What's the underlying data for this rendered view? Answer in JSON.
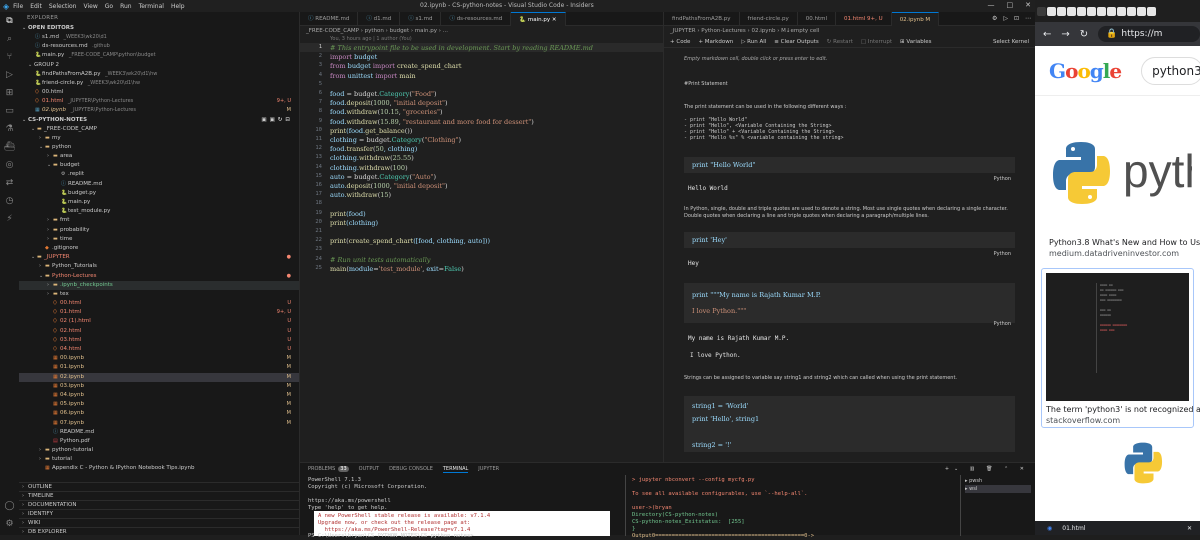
{
  "window": {
    "title": "02.ipynb - CS-python-notes - Visual Studio Code - Insiders",
    "menu": [
      "File",
      "Edit",
      "Selection",
      "View",
      "Go",
      "Run",
      "Terminal",
      "Help"
    ]
  },
  "sidebar": {
    "header": "EXPLORER",
    "open_editors": {
      "label": "OPEN EDITORS",
      "items": [
        {
          "name": "s1.md",
          "path": "_WEEK3\\wk20\\d1",
          "color": "#cccccc"
        },
        {
          "name": "ds-resources.md",
          "path": ".github",
          "color": "#cccccc"
        },
        {
          "name": "main.py",
          "path": "_FREE-CODE_CAMP\\python\\budget",
          "color": "#cccccc"
        }
      ],
      "group2_label": "GROUP 2",
      "group2_items": [
        {
          "name": "findPathsFromA2B.py",
          "path": "_WEEK3\\wk20\\d1\\hw",
          "color": "#cccccc"
        },
        {
          "name": "friend-circle.py",
          "path": "_WEEK3\\wk20\\d1\\hw",
          "color": "#cccccc"
        },
        {
          "name": "00.html",
          "path": "",
          "color": "#cccccc"
        },
        {
          "name": "01.html",
          "path": "_JUPYTER\\Python-Lectures",
          "color": "#f48771",
          "badge": "9+, U"
        },
        {
          "name": "02.ipynb",
          "path": "_JUPYTER\\Python-Lectures",
          "color": "#e2c08d",
          "badge": "M",
          "italic": true
        }
      ]
    },
    "workspace_label": "CS-PYTHON-NOTES",
    "tree": [
      {
        "indent": 1,
        "type": "folder",
        "open": true,
        "name": "_FREE-CODE_CAMP",
        "color": "#cccccc"
      },
      {
        "indent": 2,
        "type": "folder",
        "open": false,
        "name": "my",
        "color": "#cccccc"
      },
      {
        "indent": 2,
        "type": "folder",
        "open": true,
        "name": "python",
        "color": "#cccccc"
      },
      {
        "indent": 3,
        "type": "folder",
        "open": false,
        "name": "area",
        "color": "#cccccc"
      },
      {
        "indent": 3,
        "type": "folder",
        "open": true,
        "name": "budget",
        "color": "#cccccc"
      },
      {
        "indent": 4,
        "type": "file",
        "name": ".replit",
        "color": "#cccccc",
        "icon": "gear"
      },
      {
        "indent": 4,
        "type": "file",
        "name": "README.md",
        "color": "#cccccc",
        "icon": "info"
      },
      {
        "indent": 4,
        "type": "file",
        "name": "budget.py",
        "color": "#cccccc",
        "icon": "py"
      },
      {
        "indent": 4,
        "type": "file",
        "name": "main.py",
        "color": "#cccccc",
        "icon": "py"
      },
      {
        "indent": 4,
        "type": "file",
        "name": "test_module.py",
        "color": "#cccccc",
        "icon": "py"
      },
      {
        "indent": 3,
        "type": "folder",
        "open": false,
        "name": "fmt",
        "color": "#cccccc"
      },
      {
        "indent": 3,
        "type": "folder",
        "open": false,
        "name": "probability",
        "color": "#cccccc"
      },
      {
        "indent": 3,
        "type": "folder",
        "open": false,
        "name": "time",
        "color": "#cccccc"
      },
      {
        "indent": 2,
        "type": "file",
        "name": ".gitignore",
        "color": "#cccccc",
        "icon": "git"
      },
      {
        "indent": 1,
        "type": "folder",
        "open": true,
        "name": "_JUPYTER",
        "color": "#f48771",
        "dot": true
      },
      {
        "indent": 2,
        "type": "folder",
        "open": false,
        "name": "Python_Tutorials",
        "color": "#cccccc"
      },
      {
        "indent": 2,
        "type": "folder",
        "open": true,
        "name": "Python-Lectures",
        "color": "#f48771",
        "dot": true
      },
      {
        "indent": 3,
        "type": "folder",
        "open": false,
        "name": ".ipynb_checkpoints",
        "color": "#73c991",
        "hl": true
      },
      {
        "indent": 3,
        "type": "folder",
        "open": false,
        "name": "tex",
        "color": "#cccccc"
      },
      {
        "indent": 3,
        "type": "file",
        "name": "00.html",
        "color": "#f48771",
        "icon": "html",
        "badge": "U"
      },
      {
        "indent": 3,
        "type": "file",
        "name": "01.html",
        "color": "#f48771",
        "icon": "html",
        "badge": "9+, U"
      },
      {
        "indent": 3,
        "type": "file",
        "name": "02 (1).html",
        "color": "#f48771",
        "icon": "html",
        "badge": "U"
      },
      {
        "indent": 3,
        "type": "file",
        "name": "02.html",
        "color": "#f48771",
        "icon": "html",
        "badge": "U"
      },
      {
        "indent": 3,
        "type": "file",
        "name": "03.html",
        "color": "#f48771",
        "icon": "html",
        "badge": "U"
      },
      {
        "indent": 3,
        "type": "file",
        "name": "04.html",
        "color": "#f48771",
        "icon": "html",
        "badge": "U"
      },
      {
        "indent": 3,
        "type": "file",
        "name": "00.ipynb",
        "color": "#e2c08d",
        "icon": "nb",
        "badge": "M"
      },
      {
        "indent": 3,
        "type": "file",
        "name": "01.ipynb",
        "color": "#e2c08d",
        "icon": "nb",
        "badge": "M"
      },
      {
        "indent": 3,
        "type": "file",
        "name": "02.ipynb",
        "color": "#e2c08d",
        "icon": "nb",
        "badge": "M",
        "sel": true
      },
      {
        "indent": 3,
        "type": "file",
        "name": "03.ipynb",
        "color": "#e2c08d",
        "icon": "nb",
        "badge": "M"
      },
      {
        "indent": 3,
        "type": "file",
        "name": "04.ipynb",
        "color": "#e2c08d",
        "icon": "nb",
        "badge": "M"
      },
      {
        "indent": 3,
        "type": "file",
        "name": "05.ipynb",
        "color": "#e2c08d",
        "icon": "nb",
        "badge": "M"
      },
      {
        "indent": 3,
        "type": "file",
        "name": "06.ipynb",
        "color": "#e2c08d",
        "icon": "nb",
        "badge": "M"
      },
      {
        "indent": 3,
        "type": "file",
        "name": "07.ipynb",
        "color": "#e2c08d",
        "icon": "nb",
        "badge": "M"
      },
      {
        "indent": 3,
        "type": "file",
        "name": "README.md",
        "color": "#cccccc",
        "icon": "info"
      },
      {
        "indent": 3,
        "type": "file",
        "name": "Python.pdf",
        "color": "#cccccc",
        "icon": "pdf"
      },
      {
        "indent": 2,
        "type": "folder",
        "open": false,
        "name": "python-tutorial",
        "color": "#cccccc"
      },
      {
        "indent": 2,
        "type": "folder",
        "open": false,
        "name": "tutorial",
        "color": "#cccccc"
      },
      {
        "indent": 2,
        "type": "file",
        "name": "Appendix C - Python & IPython Notebook Tips.ipynb",
        "color": "#cccccc",
        "icon": "nb"
      }
    ],
    "bottom_sections": [
      "OUTLINE",
      "TIMELINE",
      "DOCUMENTATION",
      "IDENTIFY",
      "WIKI",
      "DB EXPLORER"
    ]
  },
  "editor": {
    "tabs": [
      {
        "label": "README.md",
        "active": false
      },
      {
        "label": "d1.md",
        "active": false
      },
      {
        "label": "s1.md",
        "active": false
      },
      {
        "label": "ds-resources.md",
        "active": false
      },
      {
        "label": "main.py",
        "active": true
      }
    ],
    "breadcrumb": "_FREE-CODE_CAMP › python › budget › main.py › ...",
    "blame": "You, 3 hours ago | 1 author (You)",
    "lines": [
      [
        {
          "t": "# This entrypoint file to be used in development. Start by reading README.md",
          "c": "cm"
        }
      ],
      [
        {
          "t": "import",
          "c": "kw"
        },
        {
          "t": " budget",
          "c": "id"
        }
      ],
      [
        {
          "t": "from",
          "c": "kw"
        },
        {
          "t": " budget ",
          "c": "id"
        },
        {
          "t": "import",
          "c": "kw"
        },
        {
          "t": " create_spend_chart",
          "c": "fn"
        }
      ],
      [
        {
          "t": "from",
          "c": "kw"
        },
        {
          "t": " unittest ",
          "c": "id"
        },
        {
          "t": "import",
          "c": "kw"
        },
        {
          "t": " main",
          "c": "fn"
        }
      ],
      [],
      [
        {
          "t": "food",
          "c": "id"
        },
        {
          "t": " = budget.",
          "c": "pl"
        },
        {
          "t": "Category",
          "c": "cls"
        },
        {
          "t": "(",
          "c": "pl"
        },
        {
          "t": "\"Food\"",
          "c": "st"
        },
        {
          "t": ")",
          "c": "pl"
        }
      ],
      [
        {
          "t": "food.",
          "c": "id"
        },
        {
          "t": "deposit",
          "c": "fn"
        },
        {
          "t": "(",
          "c": "pl"
        },
        {
          "t": "1000",
          "c": "nm"
        },
        {
          "t": ", ",
          "c": "pl"
        },
        {
          "t": "\"initial deposit\"",
          "c": "st"
        },
        {
          "t": ")",
          "c": "pl"
        }
      ],
      [
        {
          "t": "food.",
          "c": "id"
        },
        {
          "t": "withdraw",
          "c": "fn"
        },
        {
          "t": "(",
          "c": "pl"
        },
        {
          "t": "10.15",
          "c": "nm"
        },
        {
          "t": ", ",
          "c": "pl"
        },
        {
          "t": "\"groceries\"",
          "c": "st"
        },
        {
          "t": ")",
          "c": "pl"
        }
      ],
      [
        {
          "t": "food.",
          "c": "id"
        },
        {
          "t": "withdraw",
          "c": "fn"
        },
        {
          "t": "(",
          "c": "pl"
        },
        {
          "t": "15.89",
          "c": "nm"
        },
        {
          "t": ", ",
          "c": "pl"
        },
        {
          "t": "\"restaurant and more food for dessert\"",
          "c": "st"
        },
        {
          "t": ")",
          "c": "pl"
        }
      ],
      [
        {
          "t": "print",
          "c": "fn"
        },
        {
          "t": "(food.",
          "c": "id"
        },
        {
          "t": "get_balance",
          "c": "fn"
        },
        {
          "t": "())",
          "c": "pl"
        }
      ],
      [
        {
          "t": "clothing",
          "c": "id"
        },
        {
          "t": " = budget.",
          "c": "pl"
        },
        {
          "t": "Category",
          "c": "cls"
        },
        {
          "t": "(",
          "c": "pl"
        },
        {
          "t": "\"Clothing\"",
          "c": "st"
        },
        {
          "t": ")",
          "c": "pl"
        }
      ],
      [
        {
          "t": "food.",
          "c": "id"
        },
        {
          "t": "transfer",
          "c": "fn"
        },
        {
          "t": "(",
          "c": "pl"
        },
        {
          "t": "50",
          "c": "nm"
        },
        {
          "t": ", clothing)",
          "c": "id"
        }
      ],
      [
        {
          "t": "clothing.",
          "c": "id"
        },
        {
          "t": "withdraw",
          "c": "fn"
        },
        {
          "t": "(",
          "c": "pl"
        },
        {
          "t": "25.55",
          "c": "nm"
        },
        {
          "t": ")",
          "c": "pl"
        }
      ],
      [
        {
          "t": "clothing.",
          "c": "id"
        },
        {
          "t": "withdraw",
          "c": "fn"
        },
        {
          "t": "(",
          "c": "pl"
        },
        {
          "t": "100",
          "c": "nm"
        },
        {
          "t": ")",
          "c": "pl"
        }
      ],
      [
        {
          "t": "auto",
          "c": "id"
        },
        {
          "t": " = budget.",
          "c": "pl"
        },
        {
          "t": "Category",
          "c": "cls"
        },
        {
          "t": "(",
          "c": "pl"
        },
        {
          "t": "\"Auto\"",
          "c": "st"
        },
        {
          "t": ")",
          "c": "pl"
        }
      ],
      [
        {
          "t": "auto.",
          "c": "id"
        },
        {
          "t": "deposit",
          "c": "fn"
        },
        {
          "t": "(",
          "c": "pl"
        },
        {
          "t": "1000",
          "c": "nm"
        },
        {
          "t": ", ",
          "c": "pl"
        },
        {
          "t": "\"initial deposit\"",
          "c": "st"
        },
        {
          "t": ")",
          "c": "pl"
        }
      ],
      [
        {
          "t": "auto.",
          "c": "id"
        },
        {
          "t": "withdraw",
          "c": "fn"
        },
        {
          "t": "(",
          "c": "pl"
        },
        {
          "t": "15",
          "c": "nm"
        },
        {
          "t": ")",
          "c": "pl"
        }
      ],
      [],
      [
        {
          "t": "print",
          "c": "fn"
        },
        {
          "t": "(food)",
          "c": "id"
        }
      ],
      [
        {
          "t": "print",
          "c": "fn"
        },
        {
          "t": "(clothing)",
          "c": "id"
        }
      ],
      [],
      [
        {
          "t": "print",
          "c": "fn"
        },
        {
          "t": "(",
          "c": "pl"
        },
        {
          "t": "create_spend_chart",
          "c": "fn"
        },
        {
          "t": "([food, clothing, auto]))",
          "c": "id"
        }
      ],
      [],
      [
        {
          "t": "# Run unit tests automatically",
          "c": "cm"
        }
      ],
      [
        {
          "t": "main",
          "c": "fn"
        },
        {
          "t": "(",
          "c": "pl"
        },
        {
          "t": "module",
          "c": "id"
        },
        {
          "t": "=",
          "c": "pl"
        },
        {
          "t": "'test_module'",
          "c": "st"
        },
        {
          "t": ", ",
          "c": "pl"
        },
        {
          "t": "exit",
          "c": "id"
        },
        {
          "t": "=",
          "c": "pl"
        },
        {
          "t": "False",
          "c": "cls"
        },
        {
          "t": ")",
          "c": "pl"
        }
      ]
    ]
  },
  "notebook": {
    "tabs": [
      {
        "label": "findPathsFromA2B.py",
        "color": "#9d9d9d"
      },
      {
        "label": "friend-circle.py",
        "color": "#9d9d9d"
      },
      {
        "label": "00.html",
        "color": "#9d9d9d"
      },
      {
        "label": "01.html 9+, U",
        "color": "#f48771"
      },
      {
        "label": "02.ipynb M",
        "color": "#e2c08d",
        "active": true
      }
    ],
    "breadcrumb": "_JUPYTER › Python-Lectures › 02.ipynb › M↓empty cell",
    "toolbar": [
      "+ Code",
      "+ Markdown",
      "▷ Run All",
      "≡ Clear Outputs",
      "↻ Restart",
      "□ Interrupt",
      "⊞ Variables"
    ],
    "kernel": "Select Kernel",
    "empty_md": "Empty markdown cell, double click or press enter to edit.",
    "heading": "#Print Statement",
    "intro": "The print statement can be used in the following different ways :",
    "ways": [
      "- print \"Hello World\"",
      "- print \"Hello\", <Variable Containing the String>",
      "- print \"Hello\" + <Variable Containing the String>",
      "- print \"Hello %s\" % <variable containing the string>"
    ],
    "cell1": "print \"Hello World\"",
    "out1": "Hello World",
    "para1": "In Python, single, double and triple quotes are used to denote a string. Most use single quotes when declaring a single character. Double quotes when declaring a line and triple quotes when declaring a paragraph/multiple lines.",
    "cell2": "print 'Hey'",
    "out2": "Hey",
    "cell3a": "print \"\"\"My name is Rajath Kumar M.P.",
    "cell3b": "I love Python.\"\"\"",
    "out3a": "My name is Rajath Kumar M.P.",
    "out3b": "I love Python.",
    "para2": "Strings can be assigned to variable say string1 and string2 which can called when using the print statement.",
    "cell4a": "string1 = 'World'",
    "cell4b": "print 'Hello', string1",
    "cell4c": "string2 = '!'",
    "lang": "Python"
  },
  "panel": {
    "tabs": [
      "PROBLEMS",
      "OUTPUT",
      "DEBUG CONSOLE",
      "TERMINAL",
      "JUPYTER"
    ],
    "problems_count": "33",
    "term_left": [
      "PowerShell 7.1.3",
      "Copyright (c) Microsoft Corporation.",
      "",
      "https://aka.ms/powershell",
      "Type 'help' to get help."
    ],
    "term_notice": [
      "A new PowerShell stable release is available: v7.1.4",
      "Upgrade now, or check out the release page at:",
      "  https://aka.ms/PowerShell-Release?tag=v7.1.4"
    ],
    "term_prompt": "PS C:\\Users\\bryan\\CS-PYTHON-NOTES\\CS-python-notes>",
    "term_right": [
      "> jupyter nbconvert --config mycfg.py",
      "",
      "To see all available configurables, use `--help-all`.",
      "",
      "user->(bryan",
      "Directory(CS-python-notes)",
      "CS-python-notes_Exitstatus:  [255]",
      "}",
      "Output0=============================================0->"
    ],
    "shells": [
      "pwsh",
      "wsl"
    ]
  },
  "browser": {
    "url": "https://m",
    "search": "python3",
    "result1_title": "Python3.8 What's New and How to Us",
    "result1_src": "medium.datadriveninvestor.com",
    "result2_title": "The term 'python3' is not recognized a",
    "result2_src": "stackoverflow.com",
    "footer_file": "01.html",
    "python_word": "pyth",
    "google": [
      "G",
      "o",
      "o",
      "g",
      "l",
      "e"
    ]
  }
}
